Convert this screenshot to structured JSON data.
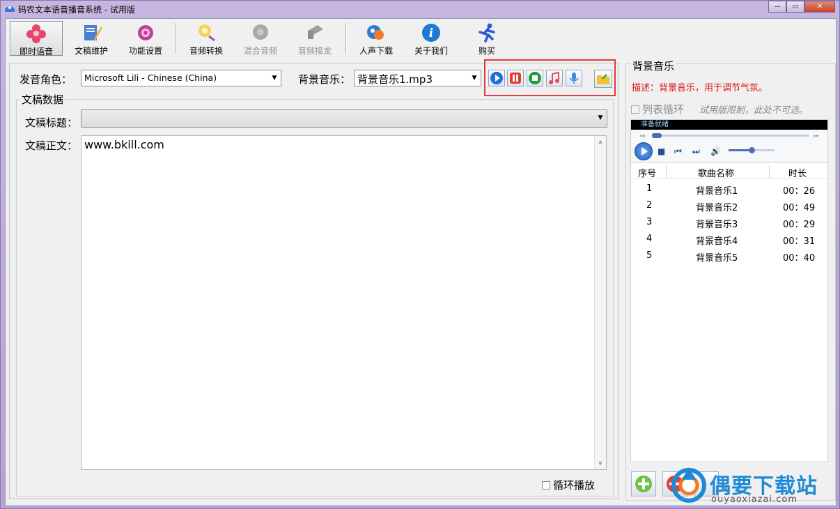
{
  "window": {
    "title": "码农文本语音播音系统 - 试用版"
  },
  "toolbar": {
    "items": [
      {
        "label": "即时语音",
        "icon": "flower-icon"
      },
      {
        "label": "文稿维护",
        "icon": "edit-doc-icon"
      },
      {
        "label": "功能设置",
        "icon": "gear-icon"
      },
      {
        "label": "音频转换",
        "icon": "audio-convert-icon"
      },
      {
        "label": "混合音频",
        "icon": "mix-audio-icon"
      },
      {
        "label": "音频接龙",
        "icon": "audio-chain-icon"
      },
      {
        "label": "人声下载",
        "icon": "voice-download-icon"
      },
      {
        "label": "关于我们",
        "icon": "info-icon"
      },
      {
        "label": "购买",
        "icon": "runner-icon"
      }
    ]
  },
  "voice": {
    "label": "发音角色：",
    "value": "Microsoft Lili - Chinese (China)"
  },
  "bgm": {
    "label": "背景音乐：",
    "value": "背景音乐1.mp3"
  },
  "doc": {
    "group_title": "文稿数据",
    "title_label": "文稿标题：",
    "title_value": "",
    "body_label": "文稿正文：",
    "body_value": "www.bkill.com",
    "loop_label": "循环播放"
  },
  "right": {
    "title": "背景音乐",
    "desc": "描述：背景音乐，用于调节气氛。",
    "list_loop_label": "列表循环",
    "trial_note": "试用版限制，此处不可选。",
    "player_status": "准备就绪",
    "columns": [
      "序号",
      "歌曲名称",
      "时长"
    ],
    "rows": [
      {
        "no": "1",
        "name": "背景音乐1",
        "duration": "00：26"
      },
      {
        "no": "2",
        "name": "背景音乐2",
        "duration": "00：49"
      },
      {
        "no": "3",
        "name": "背景音乐3",
        "duration": "00：29"
      },
      {
        "no": "4",
        "name": "背景音乐4",
        "duration": "00：31"
      },
      {
        "no": "5",
        "name": "背景音乐5",
        "duration": "00：40"
      }
    ],
    "volume_level": 0.5
  },
  "watermark": {
    "name": "偶要下载站",
    "url": "ouyaoxiazai.com"
  },
  "colors": {
    "accent_red": "#e01010",
    "highlight": "#e03a3a",
    "brand_blue": "#1e8ad6"
  }
}
